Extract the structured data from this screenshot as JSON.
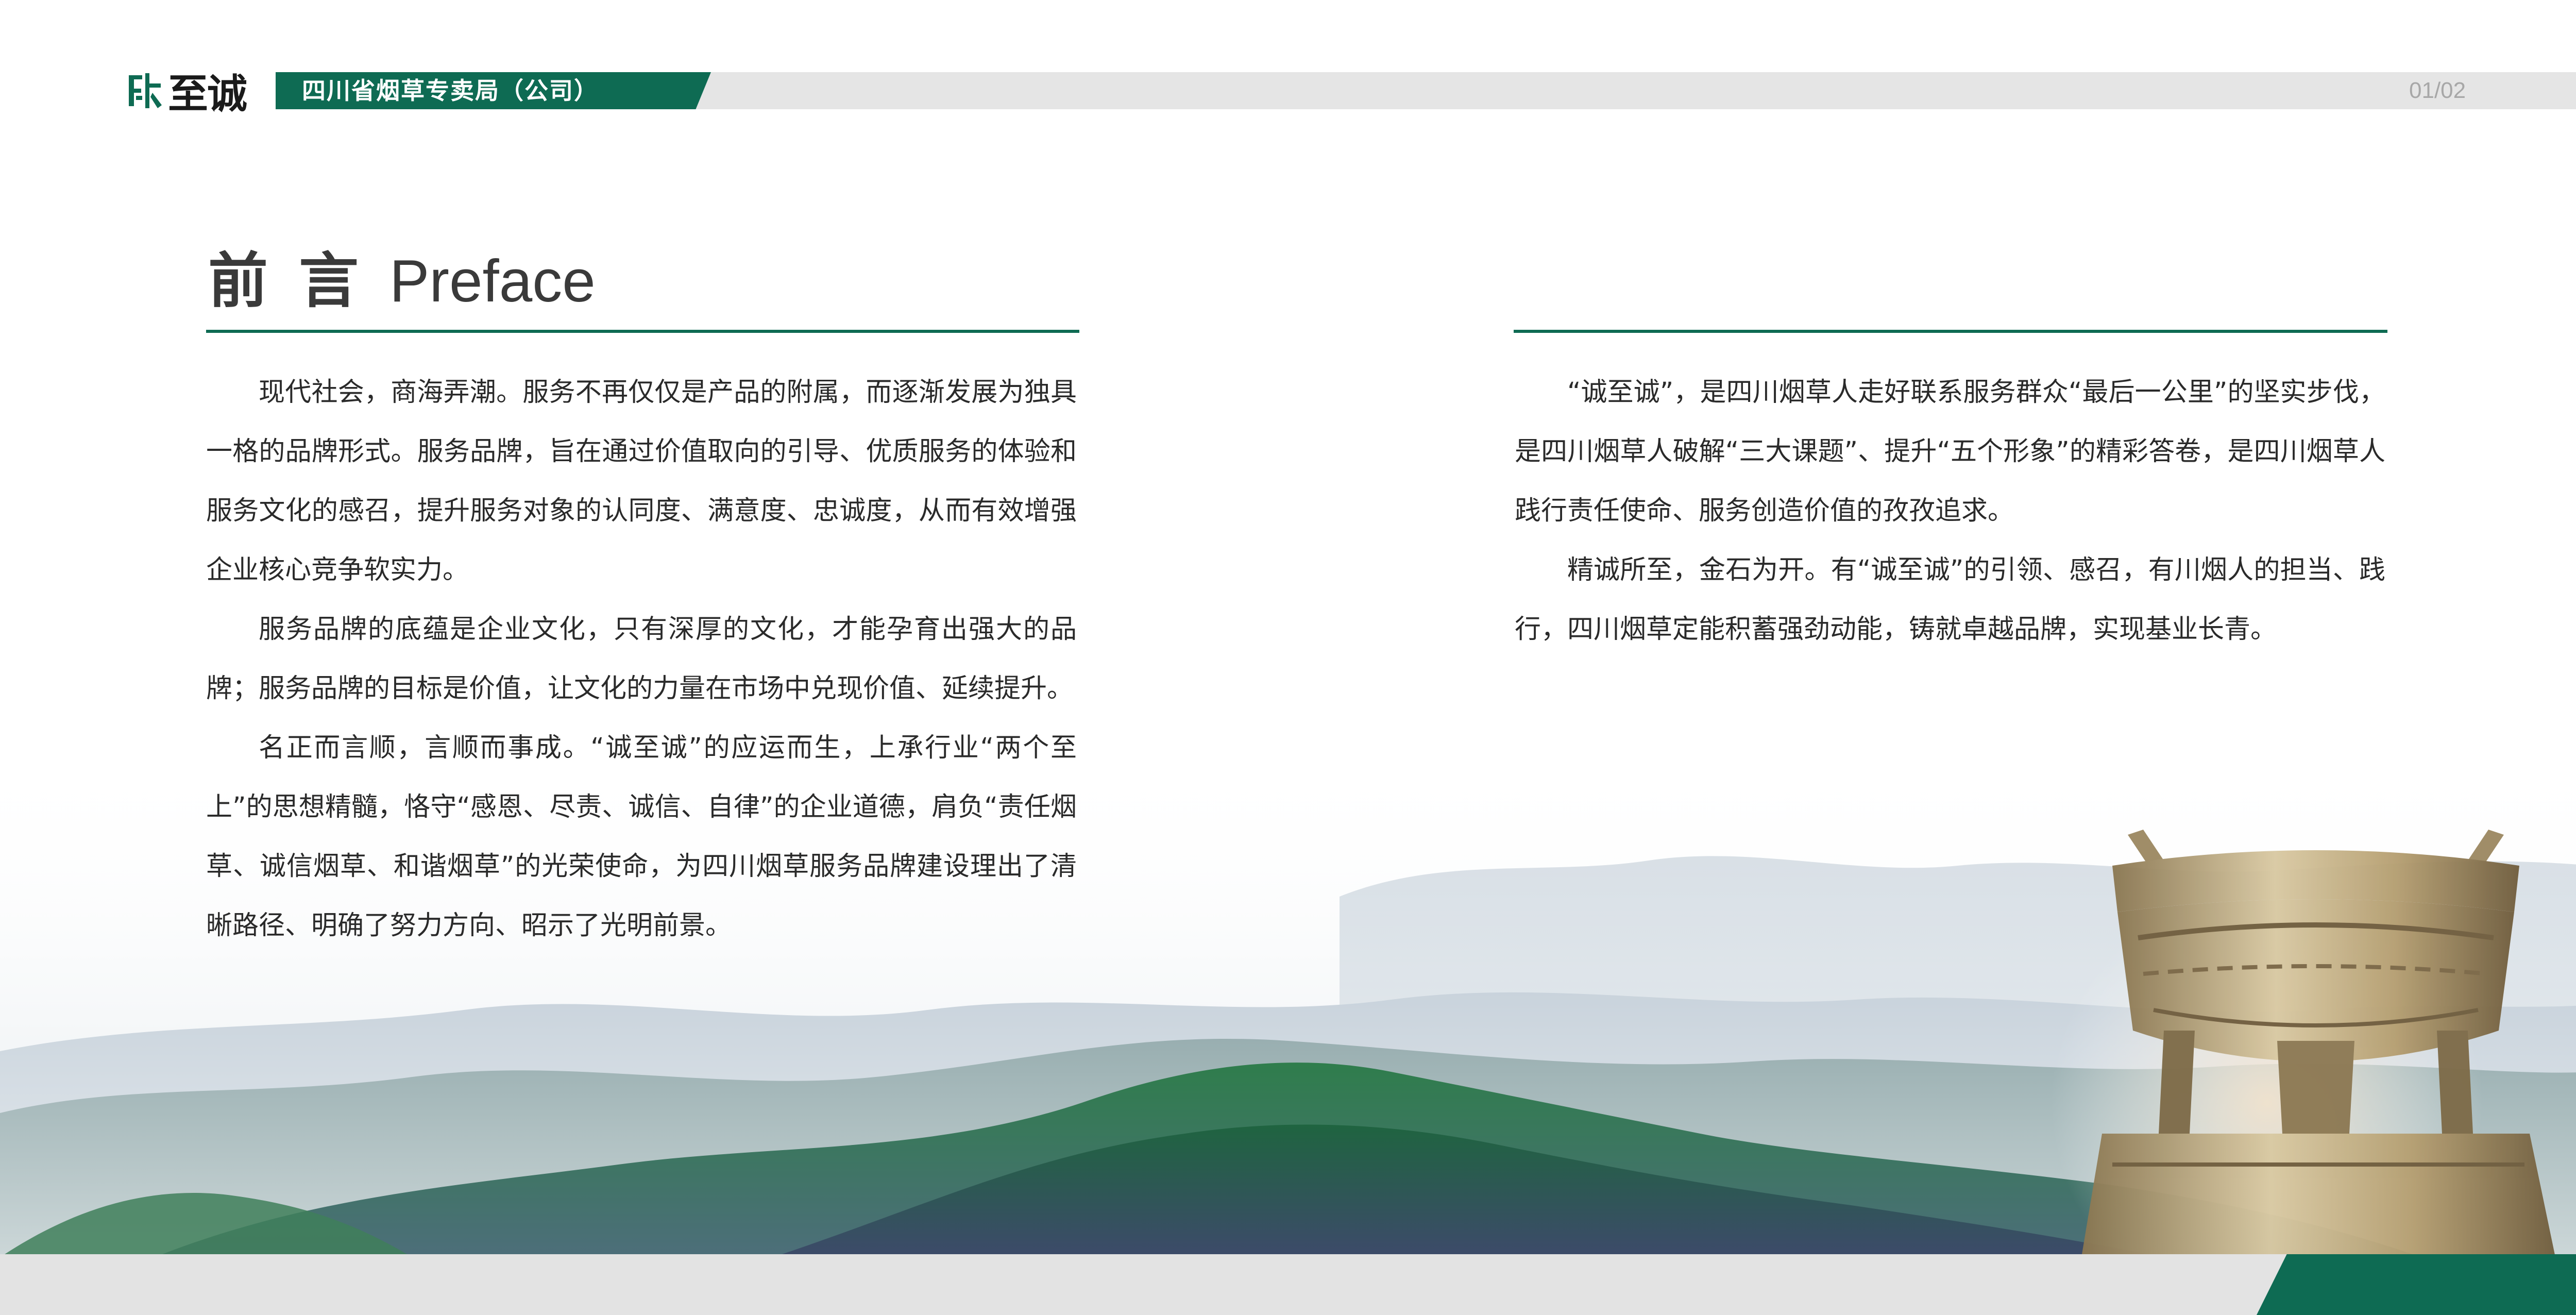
{
  "header": {
    "logo_text": "至诚",
    "organization": "四川省烟草专卖局（公司）",
    "page_number": "01/02"
  },
  "section": {
    "title_cn": "前言",
    "title_en": "Preface"
  },
  "left_column": {
    "paragraphs": [
      "现代社会，商海弄潮。服务不再仅仅是产品的附属，而逐渐发展为独具一格的品牌形式。服务品牌，旨在通过价值取向的引导、优质服务的体验和服务文化的感召，提升服务对象的认同度、满意度、忠诚度，从而有效增强企业核心竞争软实力。",
      "服务品牌的底蕴是企业文化，只有深厚的文化，才能孕育出强大的品牌；服务品牌的目标是价值，让文化的力量在市场中兑现价值、延续提升。",
      "名正而言顺，言顺而事成。“诚至诚”的应运而生，上承行业“两个至上”的思想精髓，恪守“感恩、尽责、诚信、自律”的企业道德，肩负“责任烟草、诚信烟草、和谐烟草”的光荣使命，为四川烟草服务品牌建设理出了清晰路径、明确了努力方向、昭示了光明前景。"
    ]
  },
  "right_column": {
    "paragraphs": [
      "“诚至诚”，是四川烟草人走好联系服务群众“最后一公里”的坚实步伐，是四川烟草人破解“三大课题”、提升“五个形象”的精彩答卷，是四川烟草人践行责任使命、服务创造价值的孜孜追求。",
      "精诚所至，金石为开。有“诚至诚”的引领、感召，有川烟人的担当、践行，四川烟草定能积蓄强劲动能，铸就卓越品牌，实现基业长青。"
    ]
  },
  "colors": {
    "brand_green": "#0e6b53",
    "band_gray": "#e5e5e5",
    "page_number_gray": "#a7a7a7"
  }
}
